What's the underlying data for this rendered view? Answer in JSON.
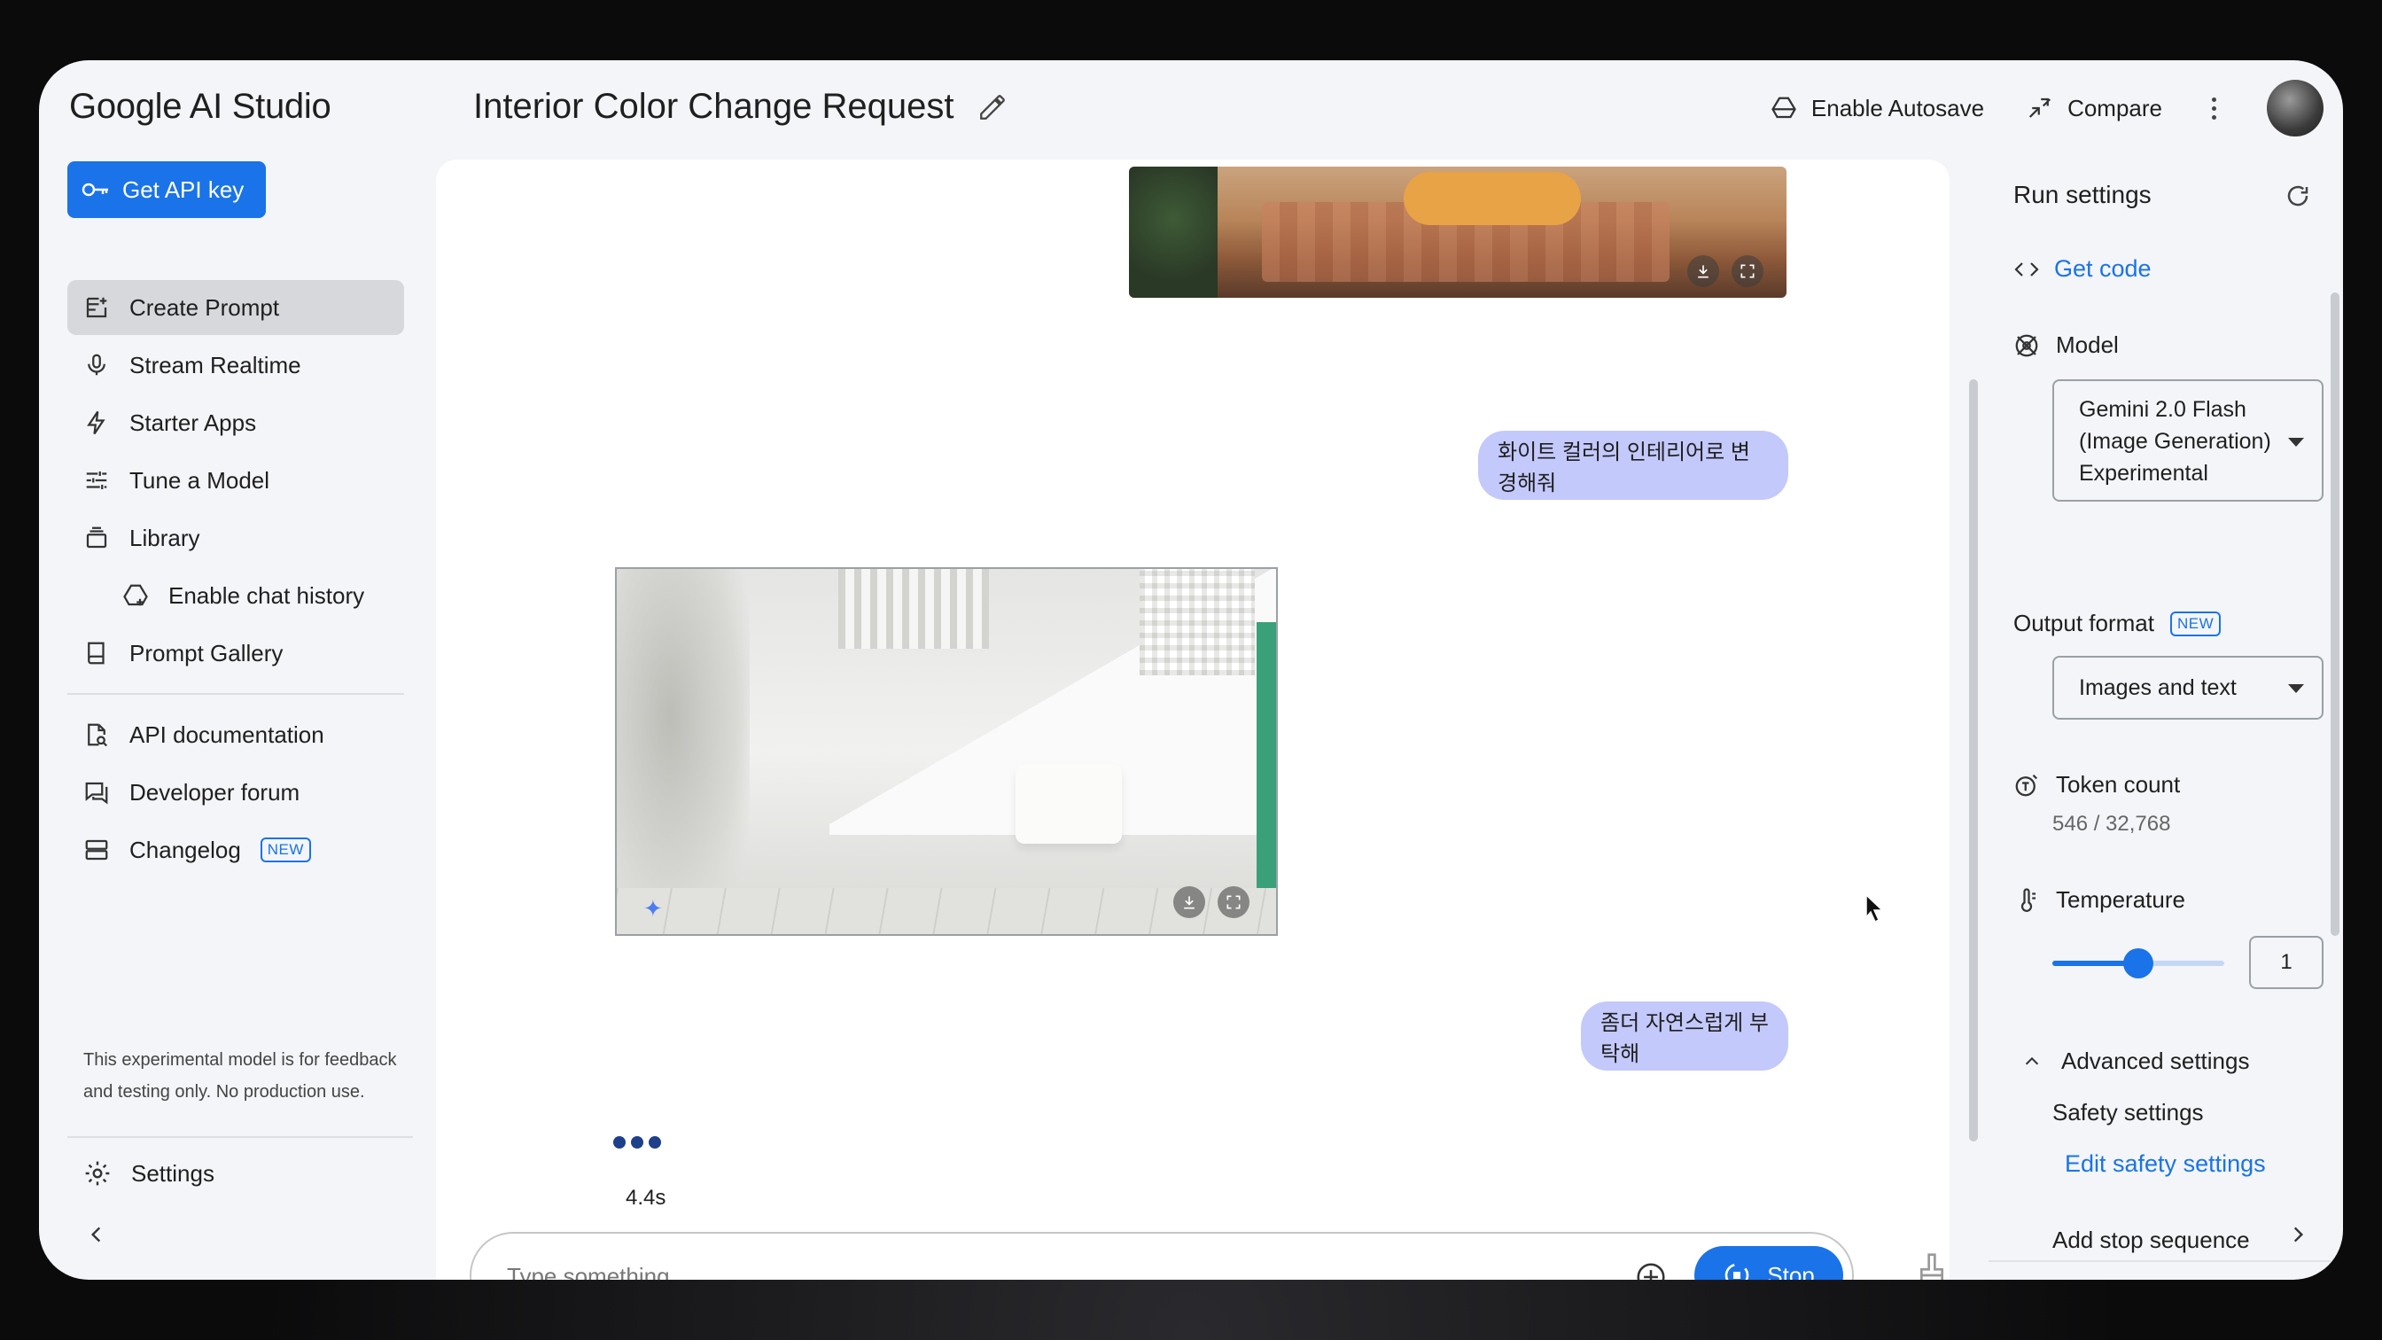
{
  "app": {
    "brand": "Google AI Studio",
    "title": "Interior Color Change Request"
  },
  "topbar": {
    "autosave_label": "Enable Autosave",
    "compare_label": "Compare"
  },
  "sidebar": {
    "api_key_label": "Get API key",
    "items": [
      {
        "label": "Create Prompt",
        "icon": "create-prompt-icon",
        "active": true
      },
      {
        "label": "Stream Realtime",
        "icon": "microphone-icon"
      },
      {
        "label": "Starter Apps",
        "icon": "bolt-icon"
      },
      {
        "label": "Tune a Model",
        "icon": "tune-icon"
      },
      {
        "label": "Library",
        "icon": "library-icon"
      },
      {
        "label": "Enable chat history",
        "icon": "drive-icon",
        "sub": true
      },
      {
        "label": "Prompt Gallery",
        "icon": "book-icon"
      }
    ],
    "links": [
      {
        "label": "API documentation",
        "icon": "doc-search-icon"
      },
      {
        "label": "Developer forum",
        "icon": "forum-icon"
      },
      {
        "label": "Changelog",
        "icon": "changelog-icon",
        "badge": "NEW"
      }
    ],
    "disclaimer": "This experimental model is for feedback and testing only. No production use.",
    "settings_label": "Settings"
  },
  "chat": {
    "messages": [
      {
        "role": "user",
        "text": "화이트 컬러의 인테리어로 변경해줘"
      },
      {
        "role": "user",
        "text": "좀더 자연스럽게 부탁해"
      }
    ],
    "elapsed": "4.4s",
    "composer": {
      "placeholder": "Type something",
      "stop_label": "Stop"
    }
  },
  "run_settings": {
    "title": "Run settings",
    "get_code_label": "Get code",
    "model_label": "Model",
    "model_value_line1": "Gemini 2.0 Flash",
    "model_value_line2": "(Image Generation)",
    "model_value_line3": "Experimental",
    "output_format_label": "Output format",
    "output_format_badge": "NEW",
    "output_format_value": "Images and text",
    "token_count_label": "Token count",
    "token_count_value": "546 / 32,768",
    "temperature_label": "Temperature",
    "temperature_value": "1",
    "temperature_fraction": 0.5,
    "advanced_label": "Advanced settings",
    "safety_label": "Safety settings",
    "safety_link": "Edit safety settings",
    "stop_sequence_label": "Add stop sequence"
  },
  "colors": {
    "accent": "#1a73e8",
    "user_bubble": "#c3c9fb",
    "surface": "#f3f5f8"
  }
}
